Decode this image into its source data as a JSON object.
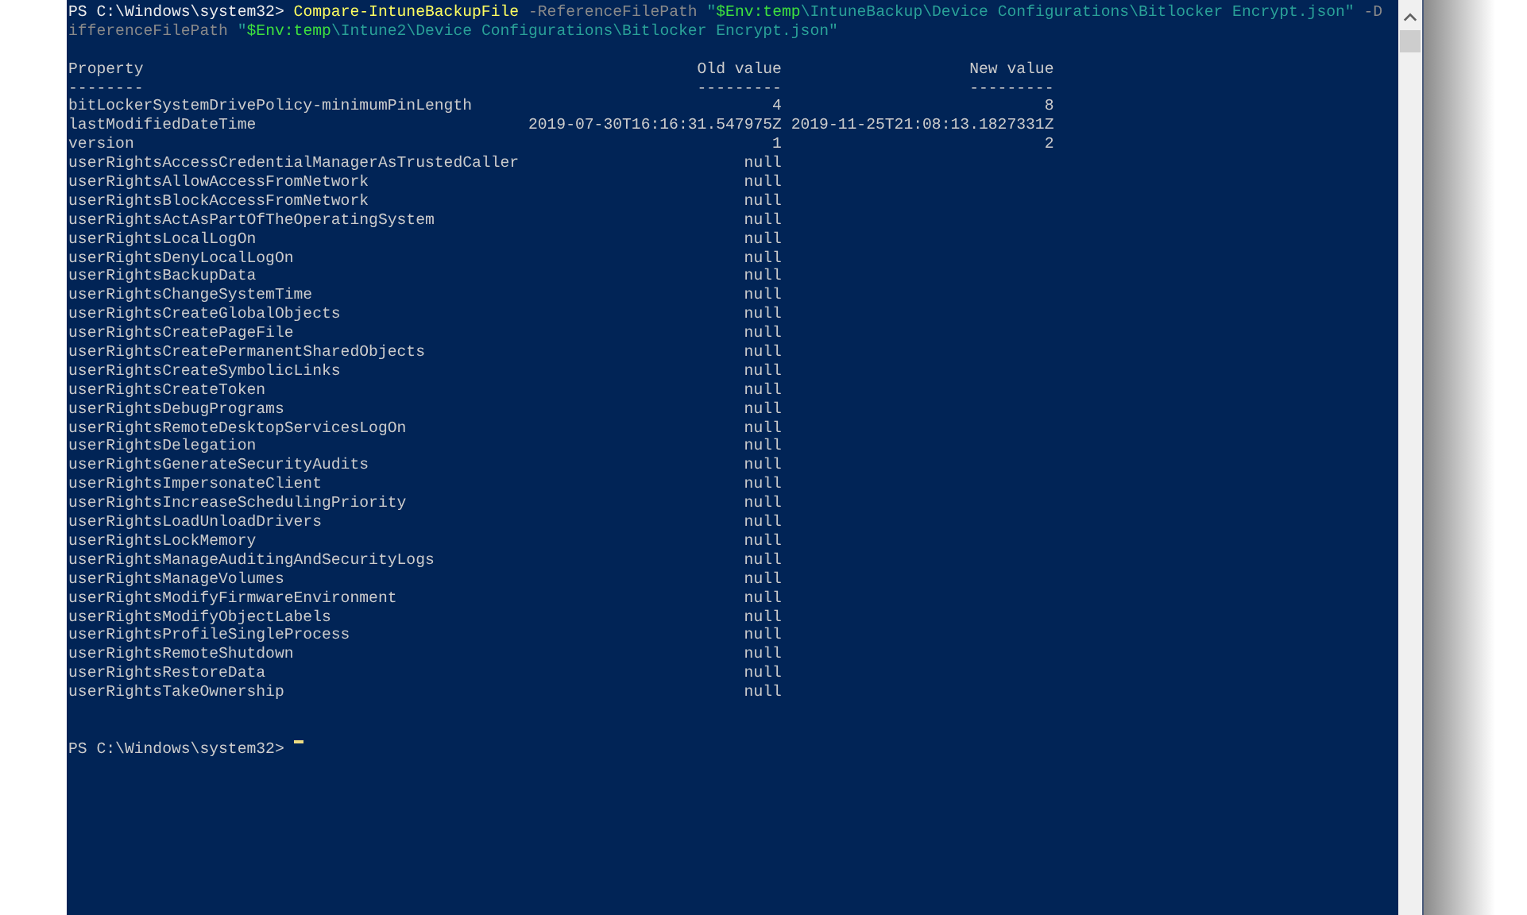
{
  "command_lines": [
    [
      {
        "kind": "prompt",
        "text": "PS C:\\Windows\\system32> "
      },
      {
        "kind": "command",
        "text": "Compare-IntuneBackupFile"
      },
      {
        "kind": "parameter",
        "text": " -ReferenceFilePath "
      },
      {
        "kind": "string",
        "text": "\""
      },
      {
        "kind": "variable",
        "text": "$Env:temp"
      },
      {
        "kind": "string",
        "text": "\\IntuneBackup\\Device Configurations\\Bitlocker Encrypt.json\""
      },
      {
        "kind": "parameter",
        "text": " -D"
      }
    ],
    [
      {
        "kind": "parameter",
        "text": "ifferenceFilePath "
      },
      {
        "kind": "string",
        "text": "\""
      },
      {
        "kind": "variable",
        "text": "$Env:temp"
      },
      {
        "kind": "string",
        "text": "\\Intune2\\Device Configurations\\Bitlocker Encrypt.json\""
      }
    ]
  ],
  "table": {
    "columns": [
      "Property",
      "Old value",
      "New value"
    ],
    "underlines": [
      "--------",
      "---------",
      "---------"
    ],
    "rows": [
      [
        "bitLockerSystemDrivePolicy-minimumPinLength",
        "4",
        "8"
      ],
      [
        "lastModifiedDateTime",
        "2019-07-30T16:16:31.547975Z",
        "2019-11-25T21:08:13.1827331Z"
      ],
      [
        "version",
        "1",
        "2"
      ],
      [
        "userRightsAccessCredentialManagerAsTrustedCaller",
        "null",
        ""
      ],
      [
        "userRightsAllowAccessFromNetwork",
        "null",
        ""
      ],
      [
        "userRightsBlockAccessFromNetwork",
        "null",
        ""
      ],
      [
        "userRightsActAsPartOfTheOperatingSystem",
        "null",
        ""
      ],
      [
        "userRightsLocalLogOn",
        "null",
        ""
      ],
      [
        "userRightsDenyLocalLogOn",
        "null",
        ""
      ],
      [
        "userRightsBackupData",
        "null",
        ""
      ],
      [
        "userRightsChangeSystemTime",
        "null",
        ""
      ],
      [
        "userRightsCreateGlobalObjects",
        "null",
        ""
      ],
      [
        "userRightsCreatePageFile",
        "null",
        ""
      ],
      [
        "userRightsCreatePermanentSharedObjects",
        "null",
        ""
      ],
      [
        "userRightsCreateSymbolicLinks",
        "null",
        ""
      ],
      [
        "userRightsCreateToken",
        "null",
        ""
      ],
      [
        "userRightsDebugPrograms",
        "null",
        ""
      ],
      [
        "userRightsRemoteDesktopServicesLogOn",
        "null",
        ""
      ],
      [
        "userRightsDelegation",
        "null",
        ""
      ],
      [
        "userRightsGenerateSecurityAudits",
        "null",
        ""
      ],
      [
        "userRightsImpersonateClient",
        "null",
        ""
      ],
      [
        "userRightsIncreaseSchedulingPriority",
        "null",
        ""
      ],
      [
        "userRightsLoadUnloadDrivers",
        "null",
        ""
      ],
      [
        "userRightsLockMemory",
        "null",
        ""
      ],
      [
        "userRightsManageAuditingAndSecurityLogs",
        "null",
        ""
      ],
      [
        "userRightsManageVolumes",
        "null",
        ""
      ],
      [
        "userRightsModifyFirmwareEnvironment",
        "null",
        ""
      ],
      [
        "userRightsModifyObjectLabels",
        "null",
        ""
      ],
      [
        "userRightsProfileSingleProcess",
        "null",
        ""
      ],
      [
        "userRightsRemoteShutdown",
        "null",
        ""
      ],
      [
        "userRightsRestoreData",
        "null",
        ""
      ],
      [
        "userRightsTakeOwnership",
        "null",
        ""
      ]
    ]
  },
  "prompt": "PS C:\\Windows\\system32> "
}
